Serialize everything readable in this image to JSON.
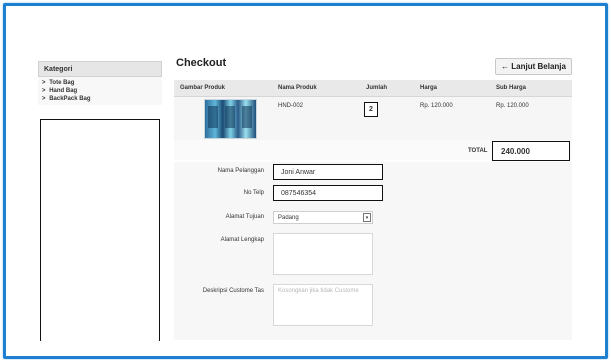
{
  "sidebar": {
    "heading": "Kategori",
    "items": [
      {
        "label": "Tote Bag"
      },
      {
        "label": "Hand Bag"
      },
      {
        "label": "BackPack Bag"
      }
    ]
  },
  "main": {
    "title": "Checkout",
    "back_button": "← Lanjut Belanja",
    "table": {
      "headers": [
        "Gambar Produk",
        "Nama Produk",
        "Jumlah",
        "Harga",
        "Sub Harga"
      ],
      "rows": [
        {
          "name": "HND-002",
          "qty": "2",
          "price": "Rp. 120.000",
          "subtotal": "Rp. 120.000"
        }
      ],
      "total_label": "TOTAL",
      "total_value": "240.000"
    },
    "form": {
      "name_label": "Nama Pelanggan",
      "name_value": "Joni Anwar",
      "phone_label": "No Telp",
      "phone_value": "087546354",
      "dest_label": "Alamat Tujuan",
      "dest_value": "Padang",
      "address_label": "Alamat Lengkap",
      "address_value": "",
      "desc_label": "Deskripsi Custome Tas",
      "desc_placeholder": "Kosongkan jika tidak Custome"
    }
  }
}
